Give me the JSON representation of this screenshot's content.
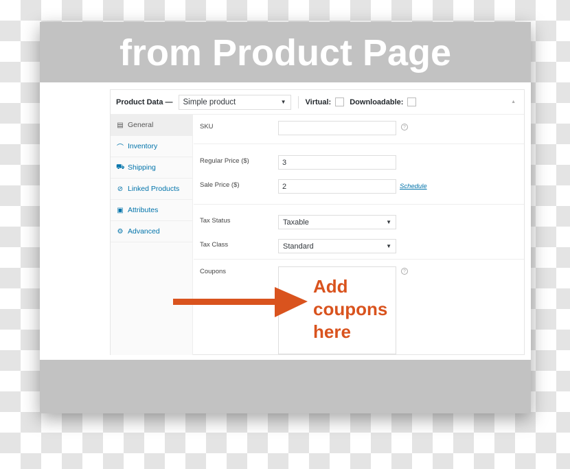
{
  "banner": {
    "title": "from Product Page"
  },
  "product_data": {
    "label": "Product Data —",
    "type_select": "Simple product",
    "virtual_label": "Virtual:",
    "downloadable_label": "Downloadable:"
  },
  "tabs": [
    {
      "label": "General",
      "icon": "general-icon"
    },
    {
      "label": "Inventory",
      "icon": "inventory-icon"
    },
    {
      "label": "Shipping",
      "icon": "truck-icon"
    },
    {
      "label": "Linked Products",
      "icon": "link-icon"
    },
    {
      "label": "Attributes",
      "icon": "attributes-icon"
    },
    {
      "label": "Advanced",
      "icon": "gear-icon"
    }
  ],
  "fields": {
    "sku_label": "SKU",
    "sku_value": "",
    "regular_price_label": "Regular Price ($)",
    "regular_price_value": "3",
    "sale_price_label": "Sale Price ($)",
    "sale_price_value": "2",
    "schedule_link": "Schedule",
    "tax_status_label": "Tax Status",
    "tax_status_value": "Taxable",
    "tax_class_label": "Tax Class",
    "tax_class_value": "Standard",
    "coupons_label": "Coupons"
  },
  "annotation": {
    "line1": "Add",
    "line2": "coupons",
    "line3": "here",
    "color": "#d9531e"
  }
}
